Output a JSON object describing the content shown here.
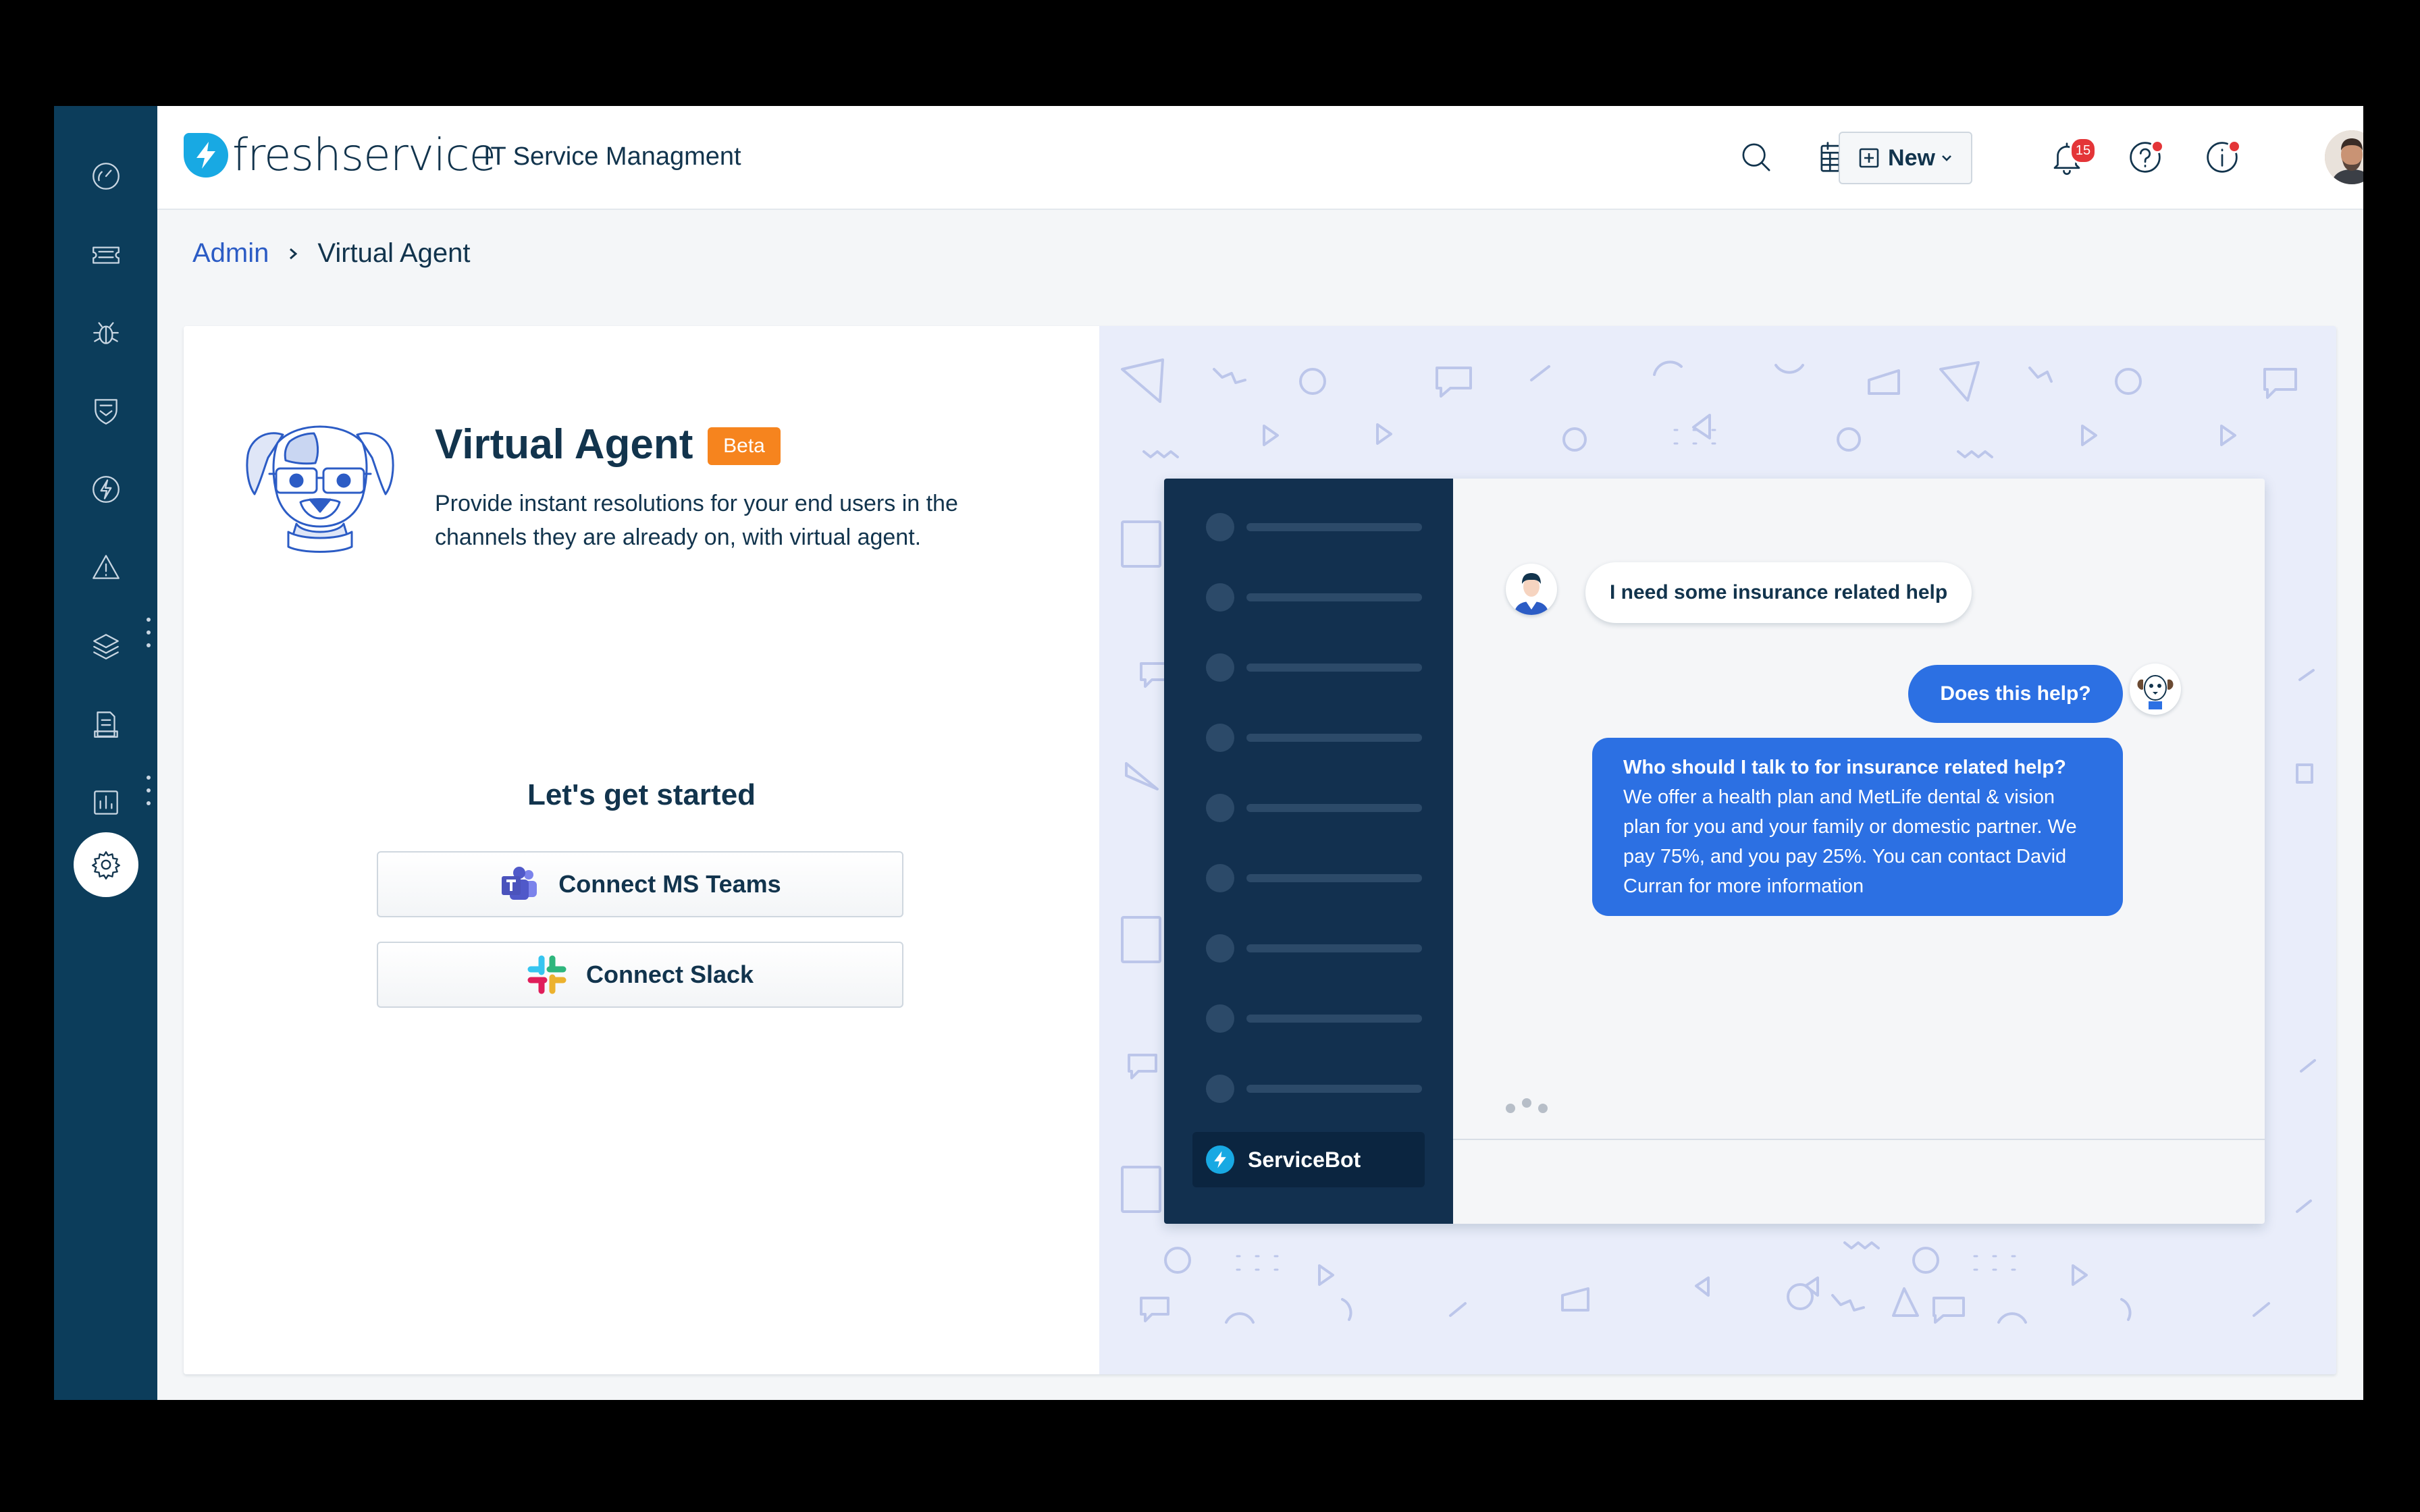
{
  "app": {
    "brand": "freshservice",
    "title": "IT Service Managment"
  },
  "sidebar": {
    "items": [
      {
        "icon": "dashboard-icon"
      },
      {
        "icon": "tickets-icon"
      },
      {
        "icon": "problems-icon"
      },
      {
        "icon": "changes-icon"
      },
      {
        "icon": "releases-icon"
      },
      {
        "icon": "alerts-icon"
      },
      {
        "icon": "assets-icon"
      },
      {
        "icon": "solutions-icon"
      },
      {
        "icon": "reports-icon"
      },
      {
        "icon": "admin-gear-icon",
        "active": true
      }
    ]
  },
  "header": {
    "new_label": "New",
    "notification_count": "15",
    "icons": [
      "search-icon",
      "calendar-icon",
      "bell-icon",
      "help-icon",
      "info-icon"
    ]
  },
  "breadcrumb": {
    "parent": "Admin",
    "current": "Virtual Agent"
  },
  "virtual_agent": {
    "title": "Virtual Agent",
    "badge": "Beta",
    "description": "Provide instant resolutions for your end users in the channels they are already on, with virtual agent.",
    "get_started": "Let's get started",
    "connect_teams": "Connect MS Teams",
    "connect_slack": "Connect Slack"
  },
  "chat_preview": {
    "bot_name": "ServiceBot",
    "user_message": "I need some insurance related help",
    "bot_message_1": "Does this help?",
    "bot_message_2_title": "Who should I talk to for insurance related help?",
    "bot_message_2_body": "We offer a health plan and MetLife dental & vision plan for you and your family or domestic partner. We pay 75%, and you pay 25%. You can contact David Curran for more information"
  },
  "colors": {
    "rail": "#0c3d5b",
    "brand_blue": "#18a9e3",
    "beta_orange": "#f6841e",
    "chat_blue": "#2c70e3",
    "link_blue": "#2c5cc5"
  }
}
